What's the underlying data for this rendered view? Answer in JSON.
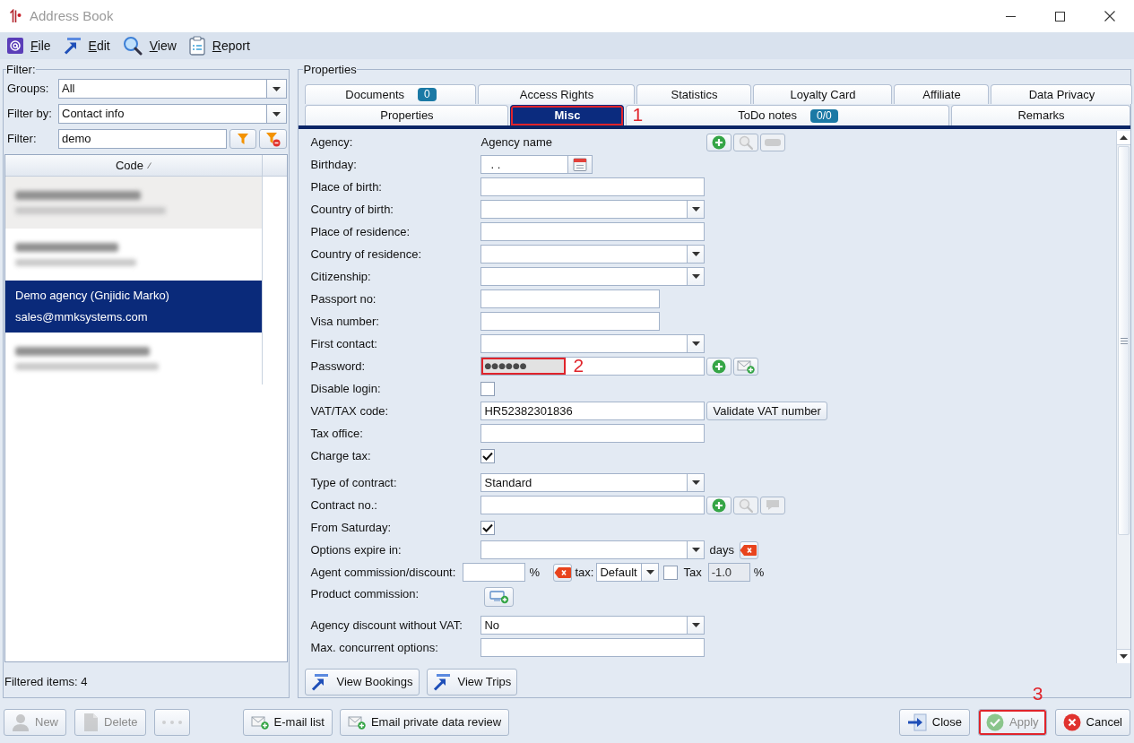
{
  "window": {
    "title": "Address Book"
  },
  "menu": [
    {
      "label": "File"
    },
    {
      "label": "Edit"
    },
    {
      "label": "View"
    },
    {
      "label": "Report"
    }
  ],
  "filter_panel": {
    "title": "Filter:",
    "fields": [
      {
        "kind": "select",
        "label": "Groups:",
        "value": "All"
      },
      {
        "kind": "select",
        "label": "Filter by:",
        "value": "Contact info"
      },
      {
        "kind": "search",
        "label": "Filter:",
        "value": "demo"
      }
    ],
    "list": {
      "columns": [
        {
          "label": "Code"
        }
      ],
      "rows": [
        {
          "redacted": true,
          "selected": false
        },
        {
          "redacted": true,
          "selected": false
        },
        {
          "redacted": false,
          "selected": true,
          "name": "Demo agency (Gnjidic Marko)",
          "email": "sales@mmksystems.com"
        },
        {
          "redacted": true,
          "selected": false
        }
      ]
    },
    "status": "Filtered items: 4"
  },
  "properties_panel": {
    "title": "Properties",
    "tab_rows": [
      [
        {
          "label": "Documents",
          "badge": "0",
          "selected": false
        },
        {
          "label": "Access Rights",
          "selected": false
        },
        {
          "label": "Statistics",
          "selected": false
        },
        {
          "label": "Loyalty Card",
          "selected": false
        },
        {
          "label": "Affiliate",
          "selected": false
        },
        {
          "label": "Data Privacy",
          "selected": false
        }
      ],
      [
        {
          "label": "Properties",
          "selected": false
        },
        {
          "label": "Misc",
          "selected": true,
          "annotation": "1"
        },
        {
          "label": "ToDo notes",
          "badge": "0/0",
          "selected": false
        },
        {
          "label": "Remarks",
          "selected": false
        }
      ]
    ],
    "form_sections": [
      [
        {
          "kind": "text",
          "label": "Agency:",
          "value": "Agency name",
          "actions": [
            {
              "kind": "add",
              "disabled": false
            },
            {
              "kind": "search",
              "disabled": true
            },
            {
              "kind": "remove",
              "disabled": true
            }
          ]
        },
        {
          "kind": "date",
          "label": "Birthday:",
          "value": ". ."
        },
        {
          "kind": "input",
          "label": "Place of birth:"
        },
        {
          "kind": "select",
          "label": "Country of birth:"
        },
        {
          "kind": "input",
          "label": "Place of residence:"
        },
        {
          "kind": "select",
          "label": "Country of residence:"
        },
        {
          "kind": "select",
          "label": "Citizenship:"
        },
        {
          "kind": "short",
          "label": "Passport no:"
        },
        {
          "kind": "short",
          "label": "Visa number:"
        },
        {
          "kind": "select",
          "label": "First contact:"
        },
        {
          "kind": "password",
          "label": "Password:",
          "value": "●●●●●●",
          "annotation": "2",
          "actions": [
            {
              "kind": "add",
              "disabled": false
            },
            {
              "kind": "send",
              "disabled": false
            }
          ]
        },
        {
          "kind": "checkbox",
          "label": "Disable login:",
          "checked": false
        },
        {
          "kind": "input",
          "label": "VAT/TAX code:",
          "value": "HR52382301836",
          "button": "Validate VAT number"
        },
        {
          "kind": "input",
          "label": "Tax office:"
        },
        {
          "kind": "checkbox",
          "label": "Charge tax:",
          "checked": true
        }
      ],
      [
        {
          "kind": "select",
          "label": "Type of contract:",
          "value": "Standard"
        },
        {
          "kind": "input",
          "label": "Contract no.:",
          "actions": [
            {
              "kind": "add",
              "disabled": false
            },
            {
              "kind": "search",
              "disabled": true
            },
            {
              "kind": "message",
              "disabled": true
            }
          ]
        },
        {
          "kind": "checkbox",
          "label": "From Saturday:",
          "checked": true
        },
        {
          "kind": "select",
          "label": "Options expire in:",
          "suffix": "days",
          "actions": [
            {
              "kind": "clear",
              "disabled": false
            }
          ]
        },
        {
          "kind": "commission",
          "label": "Agent commission/discount:",
          "unit": "%",
          "actions": [
            {
              "kind": "clear",
              "disabled": false
            }
          ],
          "tax_label": "tax:",
          "tax_select": "Default",
          "tax_checkbox": {
            "label": "Tax",
            "checked": false
          },
          "tax_value": {
            "value": "-1.0",
            "disabled": true
          },
          "tax_unit": "%"
        },
        {
          "kind": "button",
          "label": "Product commission:",
          "actions": [
            {
              "kind": "additem",
              "disabled": false
            }
          ]
        },
        {
          "kind": "select",
          "label": "Agency discount without VAT:",
          "value": "No"
        },
        {
          "kind": "input",
          "label": "Max. concurrent options:"
        }
      ]
    ],
    "buttons": [
      {
        "label": "View Bookings"
      },
      {
        "label": "View Trips"
      }
    ]
  },
  "footer": {
    "left": [
      {
        "kind": "new",
        "label": "New",
        "disabled": true
      },
      {
        "kind": "delete",
        "label": "Delete",
        "disabled": true
      },
      {
        "kind": "more",
        "disabled": true
      }
    ],
    "middle": [
      {
        "kind": "email",
        "label": "E-mail list",
        "disabled": false
      },
      {
        "kind": "email",
        "label": "Email private data review",
        "disabled": false
      }
    ],
    "right": [
      {
        "kind": "close",
        "label": "Close",
        "disabled": false
      },
      {
        "kind": "apply",
        "label": "Apply",
        "disabled": true,
        "annotation": "3"
      },
      {
        "kind": "cancel",
        "label": "Cancel",
        "disabled": false
      }
    ]
  }
}
